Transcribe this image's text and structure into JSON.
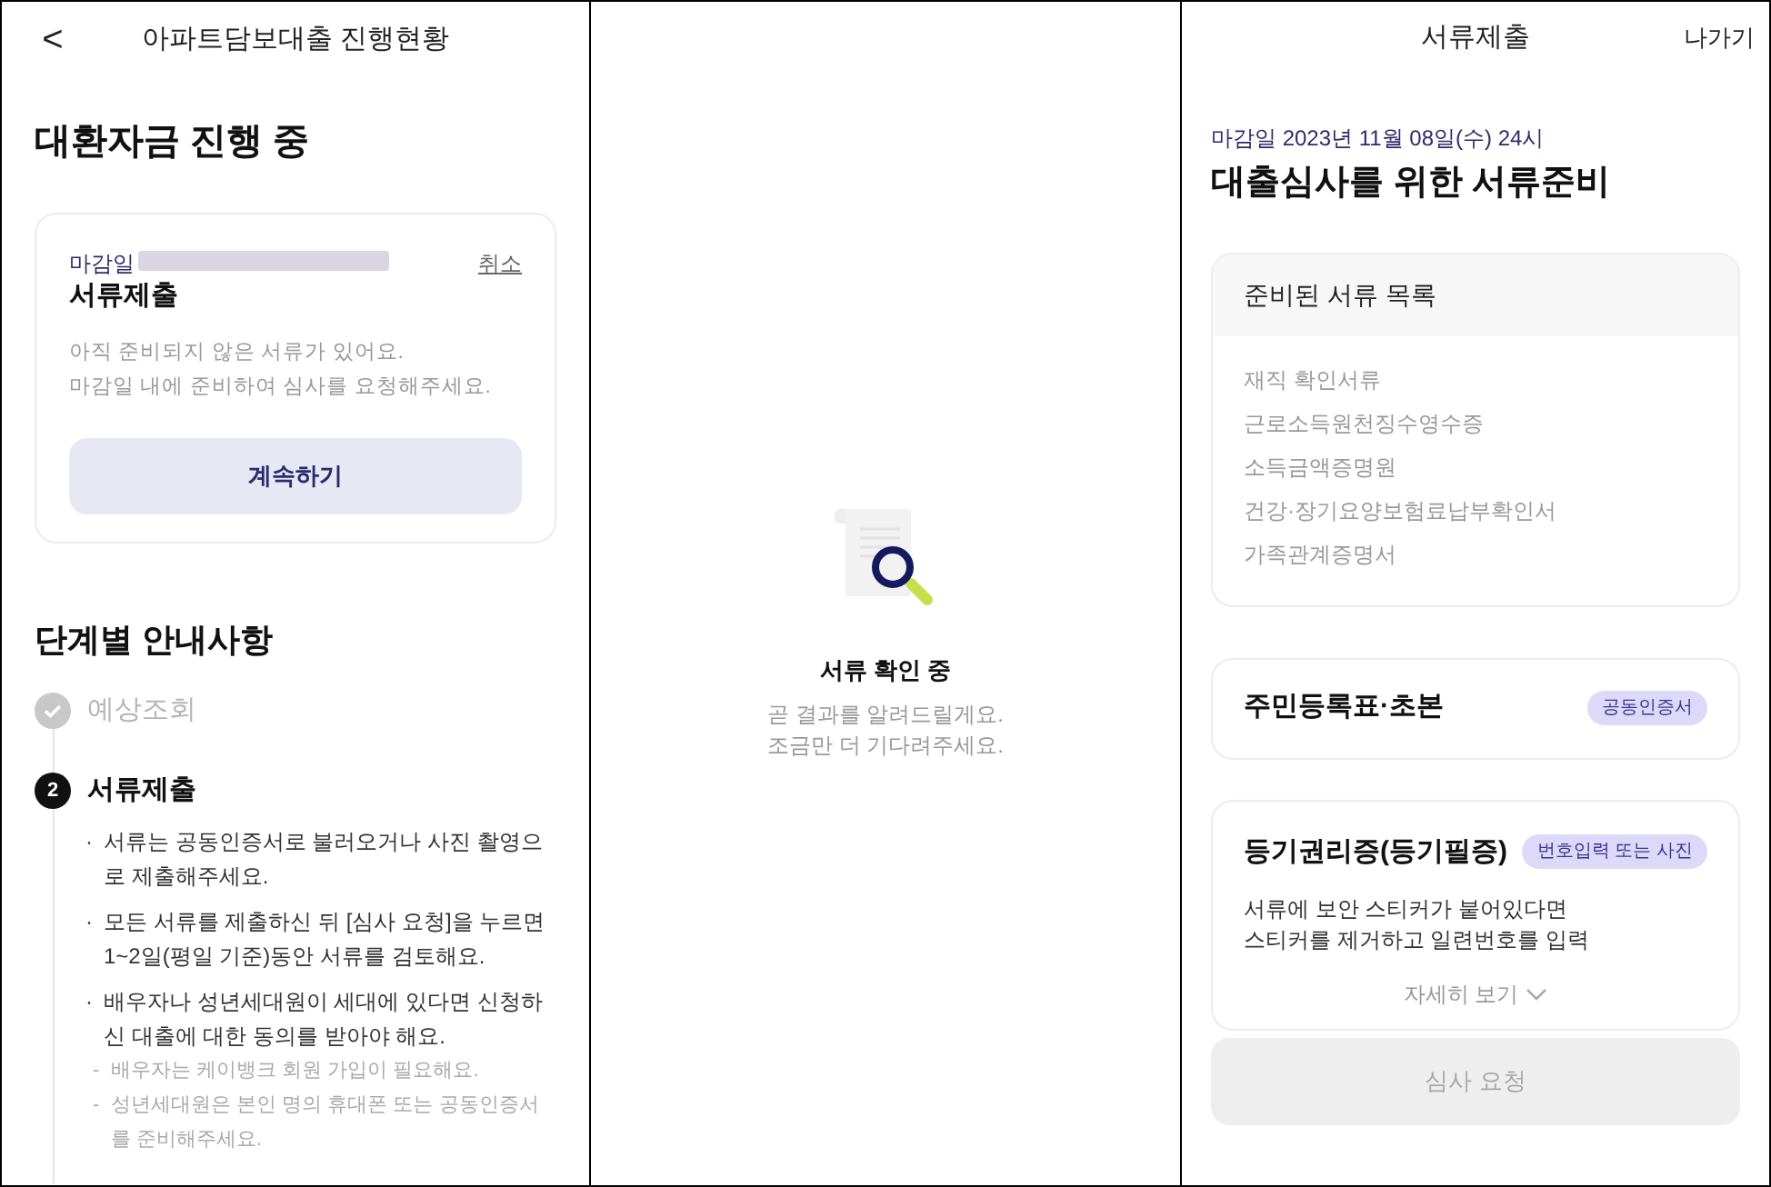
{
  "left": {
    "header": {
      "back": "<",
      "title": "아파트담보대출 진행현황"
    },
    "heading": "대환자금 진행 중",
    "card": {
      "deadline_label": "마감일",
      "deadline_redacted": true,
      "cancel": "취소",
      "title": "서류제출",
      "lines": [
        "아직 준비되지 않은 서류가 있어요.",
        "마감일 내에 준비하여 심사를 요청해주세요."
      ],
      "button": "계속하기"
    },
    "steps_title": "단계별 안내사항",
    "steps": [
      {
        "label": "예상조회",
        "done": true
      },
      {
        "number": "2",
        "label": "서류제출",
        "done": false,
        "notes": [
          {
            "marker": "·",
            "text": "서류는 공동인증서로 불러오거나 사진 촬영으로 제출해주세요."
          },
          {
            "marker": "·",
            "text": "모든 서류를 제출하신 뒤 [심사 요청]을 누르면 1~2일(평일 기준)동안 서류를 검토해요."
          },
          {
            "marker": "·",
            "text": "배우자나 성년세대원이 세대에 있다면 신청하신 대출에 대한 동의를 받아야 해요.",
            "subnotes": [
              {
                "marker": "-",
                "text": "배우자는 케이뱅크 회원 가입이 필요해요."
              },
              {
                "marker": "-",
                "text": "성년세대원은 본인 명의 휴대폰 또는 공동인증서를 준비해주세요."
              }
            ]
          }
        ]
      }
    ]
  },
  "middle": {
    "title": "서류 확인 중",
    "lines": [
      "곧 결과를 알려드릴게요.",
      "조금만 더 기다려주세요."
    ]
  },
  "right": {
    "header": {
      "title": "서류제출",
      "exit": "나가기"
    },
    "deadline": "마감일 2023년 11월 08일(수) 24시",
    "heading": "대출심사를 위한 서류준비",
    "prepared": {
      "title": "준비된 서류 목록",
      "items": [
        "재직 확인서류",
        "근로소득원천징수영수증",
        "소득금액증명원",
        "건강·장기요양보험료납부확인서",
        "가족관계증명서"
      ]
    },
    "documents": [
      {
        "title": "주민등록표·초본",
        "badge": "공동인증서"
      },
      {
        "title": "등기권리증(등기필증)",
        "badge": "번호입력 또는 사진",
        "lines": [
          "서류에 보안 스티커가 붙어있다면",
          "스티커를 제거하고 일련번호를 입력"
        ],
        "more": "자세히 보기",
        "expanded": false
      }
    ],
    "submit": {
      "label": "심사 요청",
      "disabled": true
    }
  }
}
